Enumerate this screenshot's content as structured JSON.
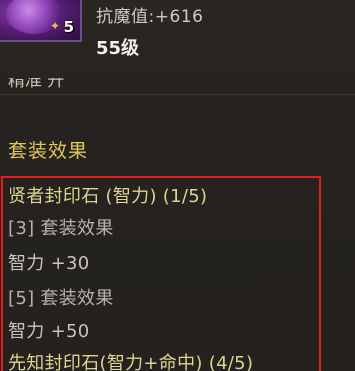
{
  "item": {
    "stack_count": "5",
    "stat_line": "抗魔值:+616",
    "level": "55级",
    "cut_off_text": "精准 升"
  },
  "set_effects": {
    "title": "套装效果",
    "lines": [
      "贤者封印石 (智力) (1/5)",
      "[3] 套装效果",
      "智力 +30",
      "[5] 套装效果",
      "智力 +50",
      "先知封印石(智力+命中) (4/5)"
    ]
  },
  "colors": {
    "background": "#25221f",
    "section_title": "#e2c65c",
    "set_header": "#ddd48f",
    "highlight_border": "#e11d1d"
  }
}
